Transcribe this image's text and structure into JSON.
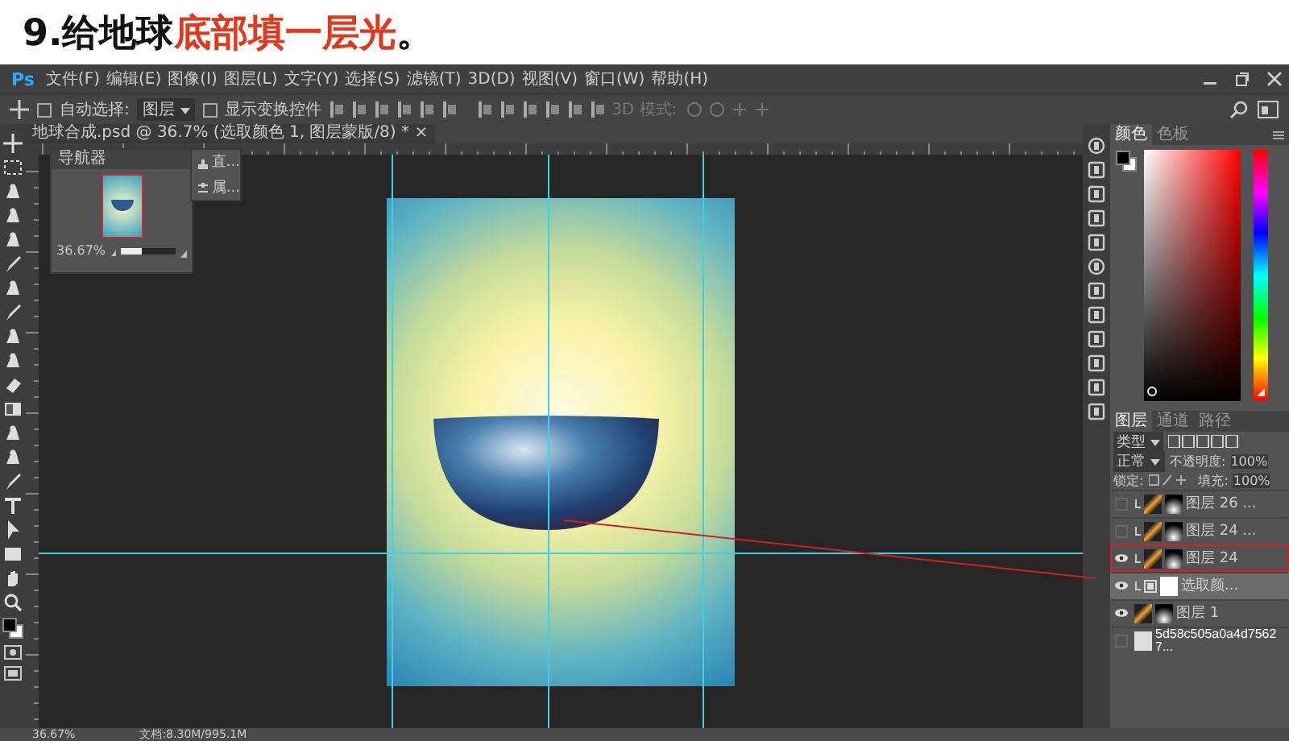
{
  "app_logo": "Ps",
  "heading": {
    "lead": "9.给地球",
    "highlight": "底部填一层光",
    "tail": "。"
  },
  "menu": [
    "文件(F)",
    "编辑(E)",
    "图像(I)",
    "图层(L)",
    "文字(Y)",
    "选择(S)",
    "滤镜(T)",
    "3D(D)",
    "视图(V)",
    "窗口(W)",
    "帮助(H)"
  ],
  "options": {
    "auto_select_label": "自动选择:",
    "auto_select_checked": false,
    "target": "图层",
    "show_transform_label": "显示变换控件",
    "show_transform_checked": false,
    "mode_3d": "3D 模式:"
  },
  "document_tab": {
    "title": "地球合成.psd @ 36.7% (选取颜色 1, 图层蒙版/8) *",
    "close": "×"
  },
  "navigator": {
    "title": "导航器",
    "zoom": "36.67%",
    "level": 0.4
  },
  "mini_panel": {
    "items": [
      "直...",
      "属..."
    ]
  },
  "color_panel": {
    "hue": {
      "level": 0.02
    },
    "tabs": [
      {
        "label": "颜色",
        "selected": true
      },
      {
        "label": "色板",
        "selected": false
      }
    ]
  },
  "layers_panel": {
    "tabs": [
      {
        "label": "图层",
        "selected": true
      },
      {
        "label": "通道",
        "selected": false
      },
      {
        "label": "路径",
        "selected": false
      }
    ],
    "filter": "类型",
    "blend_mode": "正常",
    "opacity_label": "不透明度:",
    "opacity": "100%",
    "lock_label": "锁定:",
    "fill_label": "填充:",
    "fill": "100%",
    "layers": [
      {
        "name": "图层 26 ...",
        "kind": "layer",
        "visible": false,
        "selected": false,
        "annotated": false,
        "clipped": true
      },
      {
        "name": "图层 24 ...",
        "kind": "layer",
        "visible": false,
        "selected": false,
        "annotated": false,
        "clipped": true
      },
      {
        "name": "图层 24",
        "kind": "layer",
        "visible": true,
        "selected": false,
        "annotated": true,
        "clipped": true
      },
      {
        "name": "选取颜...",
        "kind": "adjustment",
        "visible": true,
        "selected": true,
        "annotated": false,
        "clipped": true
      },
      {
        "name": "图层 1",
        "kind": "layer",
        "visible": true,
        "selected": false,
        "annotated": false,
        "clipped": false
      },
      {
        "name": "5d58c505a0a4d75627...",
        "kind": "smart",
        "visible": false,
        "selected": false,
        "annotated": false,
        "clipped": false
      }
    ]
  },
  "status_bar": {
    "zoom": "36.67%",
    "doc_size": "文档:8.30M/995.1M"
  }
}
